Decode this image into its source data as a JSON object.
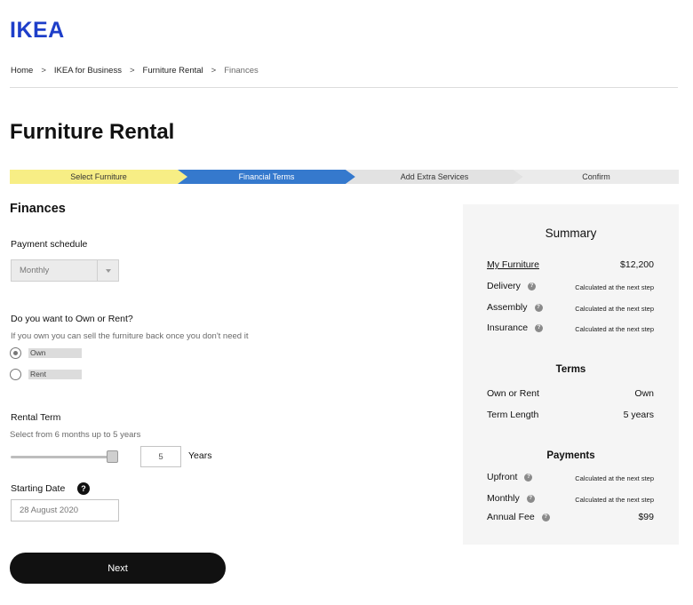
{
  "brand": {
    "logo": "IKEA"
  },
  "breadcrumb": {
    "items": [
      "Home",
      "IKEA for Business",
      "Furniture Rental",
      "Finances"
    ],
    "separator": ">"
  },
  "page": {
    "title": "Furniture Rental"
  },
  "stepper": {
    "steps": [
      "Select Furniture",
      "Financial Terms",
      "Add Extra Services",
      "Confirm"
    ],
    "active_index": 1,
    "colors": {
      "completed": "#f7ee85",
      "active": "#3579cd",
      "pending": "#e2e2e2"
    }
  },
  "finances": {
    "title": "Finances",
    "payment_schedule": {
      "label": "Payment schedule",
      "value": "Monthly"
    },
    "own_or_rent": {
      "question": "Do you want to Own or Rent?",
      "hint": "If you own you can sell the furniture back once you don't need it",
      "options": [
        "Own",
        "Rent"
      ],
      "selected": "Own"
    },
    "rental_term": {
      "label": "Rental Term",
      "hint": "Select from 6 months up to 5 years",
      "value": "5",
      "unit": "Years",
      "slider_fraction": 1.0
    },
    "starting_date": {
      "label": "Starting Date",
      "help_icon": "?",
      "value": "28 August 2020"
    },
    "next_label": "Next"
  },
  "summary": {
    "title": "Summary",
    "items": [
      {
        "label": "My Furniture",
        "value": "$12,200"
      },
      {
        "label": "Delivery",
        "value": "Calculated at the next step"
      },
      {
        "label": "Assembly",
        "value": "Calculated at the next step"
      },
      {
        "label": "Insurance",
        "value": "Calculated at the next step"
      }
    ],
    "terms": {
      "title": "Terms",
      "rows": [
        {
          "label": "Own or Rent",
          "value": "Own"
        },
        {
          "label": "Term Length",
          "value": "5 years"
        }
      ]
    },
    "payments": {
      "title": "Payments",
      "rows": [
        {
          "label": "Upfront",
          "value": "Calculated at the next step"
        },
        {
          "label": "Monthly",
          "value": "Calculated at the next step"
        },
        {
          "label": "Annual Fee",
          "value": "$99"
        }
      ]
    },
    "help_icon": "?"
  }
}
